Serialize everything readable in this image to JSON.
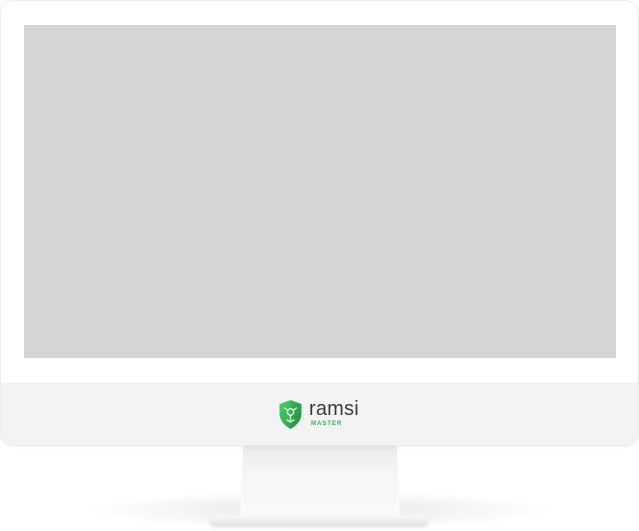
{
  "brand": {
    "name": "ramsi",
    "subtitle": "MASTER",
    "accent_color": "#2fb64c",
    "icon": "shield-icon"
  },
  "screen": {
    "fill_color": "#d5d5d5"
  }
}
